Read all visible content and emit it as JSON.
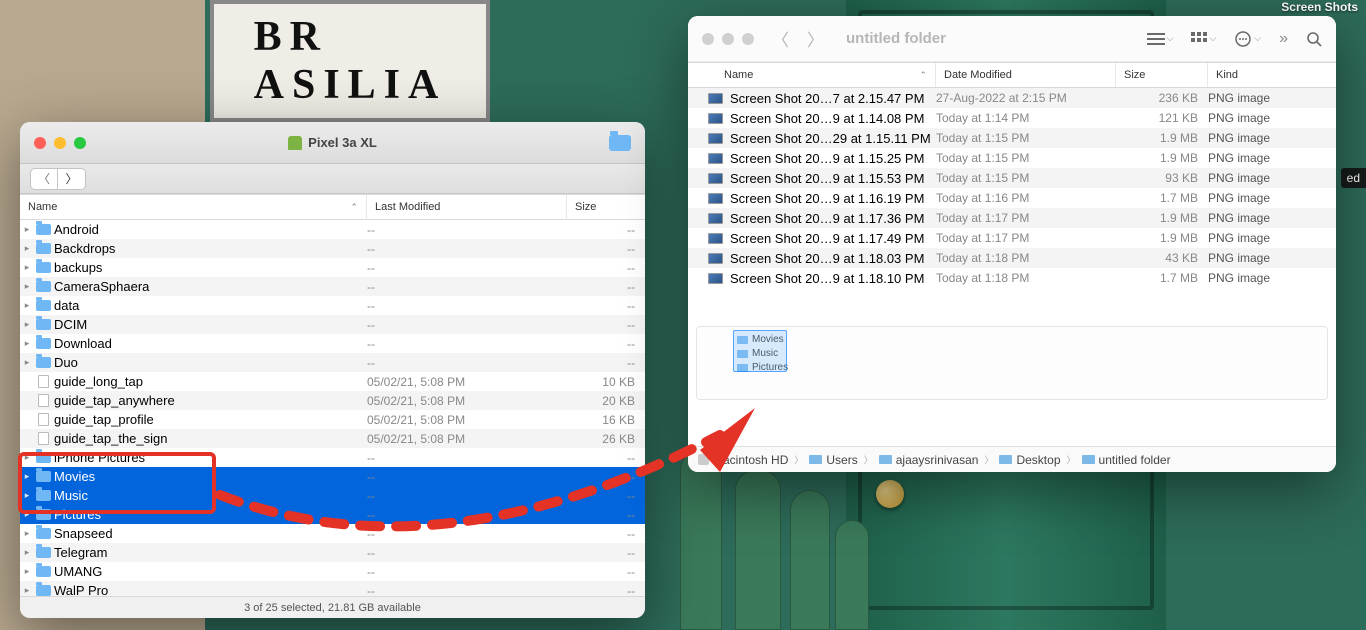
{
  "window1": {
    "title": "Pixel 3a XL",
    "columns": {
      "name": "Name",
      "modified": "Last Modified",
      "size": "Size"
    },
    "rows": [
      {
        "type": "folder",
        "disclosure": true,
        "name": "Android",
        "mod": "--",
        "size": "--",
        "sel": false
      },
      {
        "type": "folder",
        "disclosure": true,
        "name": "Backdrops",
        "mod": "--",
        "size": "--",
        "sel": false
      },
      {
        "type": "folder",
        "disclosure": true,
        "name": "backups",
        "mod": "--",
        "size": "--",
        "sel": false
      },
      {
        "type": "folder",
        "disclosure": true,
        "name": "CameraSphaera",
        "mod": "--",
        "size": "--",
        "sel": false
      },
      {
        "type": "folder",
        "disclosure": true,
        "name": "data",
        "mod": "--",
        "size": "--",
        "sel": false
      },
      {
        "type": "folder",
        "disclosure": true,
        "name": "DCIM",
        "mod": "--",
        "size": "--",
        "sel": false
      },
      {
        "type": "folder",
        "disclosure": true,
        "name": "Download",
        "mod": "--",
        "size": "--",
        "sel": false
      },
      {
        "type": "folder",
        "disclosure": true,
        "name": "Duo",
        "mod": "--",
        "size": "--",
        "sel": false
      },
      {
        "type": "file",
        "disclosure": false,
        "name": "guide_long_tap",
        "mod": "05/02/21, 5:08 PM",
        "size": "10 KB",
        "sel": false
      },
      {
        "type": "file",
        "disclosure": false,
        "name": "guide_tap_anywhere",
        "mod": "05/02/21, 5:08 PM",
        "size": "20 KB",
        "sel": false
      },
      {
        "type": "file",
        "disclosure": false,
        "name": "guide_tap_profile",
        "mod": "05/02/21, 5:08 PM",
        "size": "16 KB",
        "sel": false
      },
      {
        "type": "file",
        "disclosure": false,
        "name": "guide_tap_the_sign",
        "mod": "05/02/21, 5:08 PM",
        "size": "26 KB",
        "sel": false
      },
      {
        "type": "folder",
        "disclosure": true,
        "name": "iPhone Pictures",
        "mod": "--",
        "size": "--",
        "sel": false
      },
      {
        "type": "folder",
        "disclosure": true,
        "name": "Movies",
        "mod": "--",
        "size": "--",
        "sel": true
      },
      {
        "type": "folder",
        "disclosure": true,
        "name": "Music",
        "mod": "--",
        "size": "--",
        "sel": true
      },
      {
        "type": "folder",
        "disclosure": true,
        "name": "Pictures",
        "mod": "--",
        "size": "--",
        "sel": true
      },
      {
        "type": "folder",
        "disclosure": true,
        "name": "Snapseed",
        "mod": "--",
        "size": "--",
        "sel": false
      },
      {
        "type": "folder",
        "disclosure": true,
        "name": "Telegram",
        "mod": "--",
        "size": "--",
        "sel": false
      },
      {
        "type": "folder",
        "disclosure": true,
        "name": "UMANG",
        "mod": "--",
        "size": "--",
        "sel": false
      },
      {
        "type": "folder",
        "disclosure": true,
        "name": "WalP Pro",
        "mod": "--",
        "size": "--",
        "sel": false
      }
    ],
    "status": "3 of 25 selected, 21.81 GB available"
  },
  "window2": {
    "title": "untitled folder",
    "columns": {
      "name": "Name",
      "modified": "Date Modified",
      "size": "Size",
      "kind": "Kind"
    },
    "rows": [
      {
        "name": "Screen Shot 20…7 at 2.15.47 PM",
        "mod": "27-Aug-2022 at 2:15 PM",
        "size": "236 KB",
        "kind": "PNG image"
      },
      {
        "name": "Screen Shot 20…9 at 1.14.08 PM",
        "mod": "Today at 1:14 PM",
        "size": "121 KB",
        "kind": "PNG image"
      },
      {
        "name": "Screen Shot 20…29 at 1.15.11 PM",
        "mod": "Today at 1:15 PM",
        "size": "1.9 MB",
        "kind": "PNG image"
      },
      {
        "name": "Screen Shot 20…9 at 1.15.25 PM",
        "mod": "Today at 1:15 PM",
        "size": "1.9 MB",
        "kind": "PNG image"
      },
      {
        "name": "Screen Shot 20…9 at 1.15.53 PM",
        "mod": "Today at 1:15 PM",
        "size": "93 KB",
        "kind": "PNG image"
      },
      {
        "name": "Screen Shot 20…9 at 1.16.19 PM",
        "mod": "Today at 1:16 PM",
        "size": "1.7 MB",
        "kind": "PNG image"
      },
      {
        "name": "Screen Shot 20…9 at 1.17.36 PM",
        "mod": "Today at 1:17 PM",
        "size": "1.9 MB",
        "kind": "PNG image"
      },
      {
        "name": "Screen Shot 20…9 at 1.17.49 PM",
        "mod": "Today at 1:17 PM",
        "size": "1.9 MB",
        "kind": "PNG image"
      },
      {
        "name": "Screen Shot 20…9 at 1.18.03 PM",
        "mod": "Today at 1:18 PM",
        "size": "43 KB",
        "kind": "PNG image"
      },
      {
        "name": "Screen Shot 20…9 at 1.18.10 PM",
        "mod": "Today at 1:18 PM",
        "size": "1.7 MB",
        "kind": "PNG image"
      }
    ],
    "dropped": [
      "Movies",
      "Music",
      "Pictures"
    ],
    "breadcrumb": [
      {
        "icon": "hd",
        "label": "Macintosh HD"
      },
      {
        "icon": "folder",
        "label": "Users"
      },
      {
        "icon": "folder",
        "label": "ajaaysrinivasan"
      },
      {
        "icon": "folder",
        "label": "Desktop"
      },
      {
        "icon": "folder",
        "label": "untitled folder"
      }
    ]
  },
  "poster_text": "BR\\nASILIA",
  "right_edge_label": "ed",
  "screenshot_label": "Screen Shots"
}
